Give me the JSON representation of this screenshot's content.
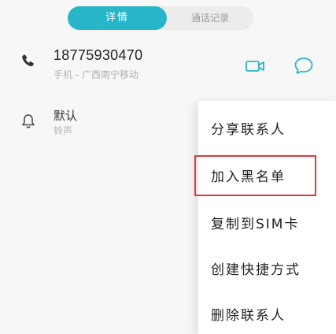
{
  "tabs": {
    "details": "详情",
    "call_log": "通话记录"
  },
  "contact": {
    "phone_number": "18775930470",
    "phone_subtitle": "手机 - 广西南宁移动",
    "ringtone_label": "默认",
    "ringtone_subtitle": "铃声"
  },
  "icons": {
    "phone": "phone-icon",
    "bell": "bell-icon",
    "video_call": "video-call-icon",
    "message": "message-icon"
  },
  "menu": {
    "items": [
      "分享联系人",
      "加入黑名单",
      "复制到SIM卡",
      "创建快捷方式",
      "删除联系人"
    ],
    "highlighted_index": 1
  },
  "colors": {
    "accent": "#27b6c8",
    "highlight_border": "#e23a3a"
  }
}
